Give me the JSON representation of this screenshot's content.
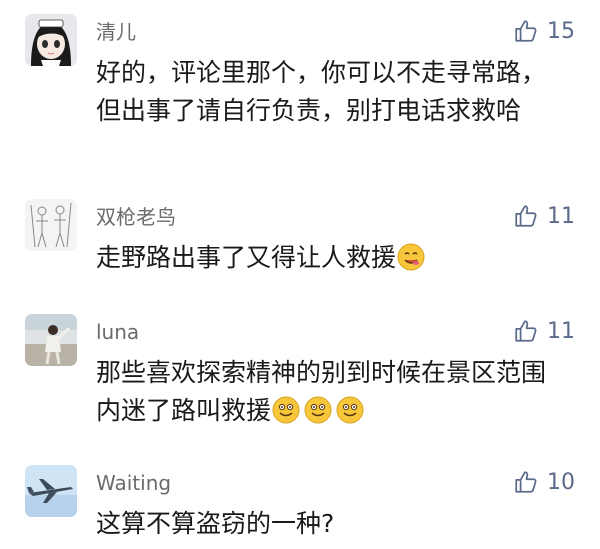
{
  "comments": [
    {
      "username": "清儿",
      "likes": "15",
      "text": "好的，评论里那个，你可以不走寻常路，但出事了请自行负责，别打电话求救哈",
      "emojis": []
    },
    {
      "username": "双枪老鸟",
      "likes": "11",
      "text": "走野路出事了又得让人救援",
      "emojis": [
        "yummy-face-icon"
      ]
    },
    {
      "username": "luna",
      "likes": "11",
      "text": "那些喜欢探索精神的别到时候在景区范围内迷了路叫救援",
      "emojis": [
        "smile-face-icon",
        "smile-face-icon",
        "smile-face-icon"
      ]
    },
    {
      "username": "Waiting",
      "likes": "10",
      "text": "这算不算盗窃的一种?",
      "emojis": []
    }
  ],
  "colors": {
    "username": "#6b6b6b",
    "like": "#5a6a8a",
    "text": "#1a1a1a"
  }
}
